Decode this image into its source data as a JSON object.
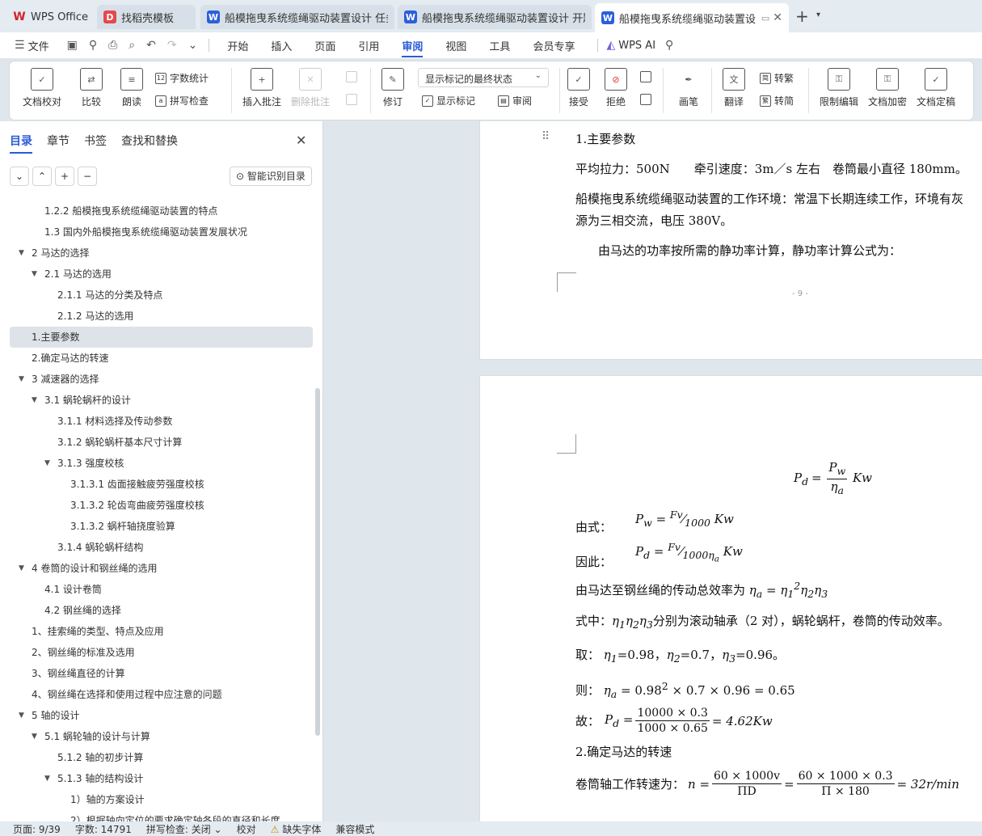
{
  "tabs": [
    {
      "title": "WPS Office",
      "icon": "wps-logo-icon"
    },
    {
      "title": "找稻壳模板",
      "icon": "docer-icon"
    },
    {
      "title": "船模拖曳系统缆绳驱动装置设计 任务",
      "icon": "word-doc-icon"
    },
    {
      "title": "船模拖曳系统缆绳驱动装置设计 开题",
      "icon": "word-doc-icon"
    },
    {
      "title": "船模拖曳系统缆绳驱动装置设",
      "icon": "word-doc-icon"
    }
  ],
  "menu": {
    "file": "文件",
    "items": [
      "开始",
      "插入",
      "页面",
      "引用",
      "审阅",
      "视图",
      "工具",
      "会员专享"
    ],
    "active": "审阅",
    "ai": "WPS AI"
  },
  "ribbon": {
    "doc_proof": "文档校对",
    "compare": "比较",
    "read_aloud": "朗读",
    "word_count": "字数统计",
    "spell_check": "拼写检查",
    "insert_comment": "插入批注",
    "delete_comment": "删除批注",
    "revise": "修订",
    "display_mode": "显示标记的最终状态",
    "show_markup": "显示标记",
    "review": "审阅",
    "accept": "接受",
    "reject": "拒绝",
    "pen": "画笔",
    "translate": "翻译",
    "to_traditional": "转繁",
    "to_simplified": "转简",
    "restrict_edit": "限制编辑",
    "encrypt": "文档加密",
    "finalize": "文档定稿"
  },
  "sidebar": {
    "tabs": [
      "目录",
      "章节",
      "书签",
      "查找和替换"
    ],
    "active_tab": "目录",
    "smart_toc": "智能识别目录",
    "toc": [
      {
        "label": "1.2.2 船模拖曳系统缆绳驱动装置的特点",
        "level": 2,
        "expand": ""
      },
      {
        "label": "1.3 国内外船模拖曳系统缆绳驱动装置发展状况",
        "level": 2,
        "expand": ""
      },
      {
        "label": "2 马达的选择",
        "level": 1,
        "expand": "▼"
      },
      {
        "label": "2.1 马达的选用",
        "level": 2,
        "expand": "▼"
      },
      {
        "label": "2.1.1 马达的分类及特点",
        "level": 3,
        "expand": ""
      },
      {
        "label": "2.1.2 马达的选用",
        "level": 3,
        "expand": ""
      },
      {
        "label": "1.主要参数",
        "level": 1,
        "expand": "",
        "selected": true
      },
      {
        "label": "2.确定马达的转速",
        "level": 1,
        "expand": ""
      },
      {
        "label": "3 减速器的选择",
        "level": 1,
        "expand": "▼"
      },
      {
        "label": "3.1 蜗轮蜗杆的设计",
        "level": 2,
        "expand": "▼"
      },
      {
        "label": "3.1.1 材料选择及传动参数",
        "level": 3,
        "expand": ""
      },
      {
        "label": "3.1.2 蜗轮蜗杆基本尺寸计算",
        "level": 3,
        "expand": ""
      },
      {
        "label": "3.1.3 强度校核",
        "level": 3,
        "expand": "▼"
      },
      {
        "label": "3.1.3.1 齿面接触疲劳强度校核",
        "level": 4,
        "expand": ""
      },
      {
        "label": "3.1.3.2 轮齿弯曲疲劳强度校核",
        "level": 4,
        "expand": ""
      },
      {
        "label": "3.1.3.2 蜗杆轴挠度验算",
        "level": 4,
        "expand": ""
      },
      {
        "label": "3.1.4 蜗轮蜗杆结构",
        "level": 3,
        "expand": ""
      },
      {
        "label": "4 卷筒的设计和钢丝绳的选用",
        "level": 1,
        "expand": "▼"
      },
      {
        "label": "4.1 设计卷筒",
        "level": 2,
        "expand": ""
      },
      {
        "label": "4.2 钢丝绳的选择",
        "level": 2,
        "expand": ""
      },
      {
        "label": "1、挂索绳的类型、特点及应用",
        "level": 1,
        "expand": ""
      },
      {
        "label": "2、钢丝绳的标准及选用",
        "level": 1,
        "expand": ""
      },
      {
        "label": "3、钢丝绳直径的计算",
        "level": 1,
        "expand": ""
      },
      {
        "label": "4、钢丝绳在选择和使用过程中应注意的问题",
        "level": 1,
        "expand": ""
      },
      {
        "label": "5 轴的设计",
        "level": 1,
        "expand": "▼"
      },
      {
        "label": "5.1 蜗轮轴的设计与计算",
        "level": 2,
        "expand": "▼"
      },
      {
        "label": "5.1.2 轴的初步计算",
        "level": 3,
        "expand": ""
      },
      {
        "label": "5.1.3 轴的结构设计",
        "level": 3,
        "expand": "▼"
      },
      {
        "label": "1）轴的方案设计",
        "level": 4,
        "expand": ""
      },
      {
        "label": "2）根据轴向定位的要求确定轴各段的直径和长度",
        "level": 4,
        "expand": ""
      }
    ]
  },
  "document": {
    "page1": {
      "heading": "1.主要参数",
      "params": "平均拉力：500N　　牵引速度：3m／s 左右　卷筒最小直径 180mm。",
      "env1": "船模拖曳系统缆绳驱动装置的工作环境：常温下长期连续工作，环境有灰",
      "env2": "源为三相交流，电压 380V。",
      "calc": "由马达的功率按所需的静功率计算，静功率计算公式为：",
      "page_number": "- 9 -"
    },
    "page2": {
      "from_formula": "由式：",
      "therefore": "因此：",
      "efficiency_intro": "由马达至钢丝绳的传动总效率为",
      "where_prefix": "式中：",
      "where_suffix": "分别为滚动轴承（2 对），蜗轮蜗杆，卷筒的传动效率。",
      "take": "取：",
      "take_values": "η₁=0.98，η₂=0.7，η₃=0.96。",
      "then": "则：",
      "so": "故：",
      "section2": "2.确定马达的转速",
      "drum_speed": "卷筒轴工作转速为：",
      "formulas": {
        "pd_lhs": "P",
        "pd_num": "P",
        "pd_den": "η",
        "pd_unit": "Kw",
        "pw_expr": "Pw = Fv/1000 Kw",
        "pd_expr": "Pd = Fv/1000ηa Kw",
        "eta_expr": "ηa = η1²η2η3",
        "eta_symbols": "η1η2η3",
        "then_expr": "ηa = 0.98² × 0.7 × 0.96 = 0.65",
        "so_num": "10000 × 0.3",
        "so_den": "1000 × 0.65",
        "so_result": "= 4.62Kw",
        "n_num1": "60 × 1000v",
        "n_den1": "ΠD",
        "n_num2": "60 × 1000 × 0.3",
        "n_den2": "Π × 180",
        "n_result": "= 32r/min"
      }
    }
  },
  "status": {
    "page": "页面: 9/39",
    "words": "字数: 14791",
    "spell": "拼写检查: 关闭",
    "proof": "校对",
    "missing_font": "缺失字体",
    "compat": "兼容模式"
  }
}
